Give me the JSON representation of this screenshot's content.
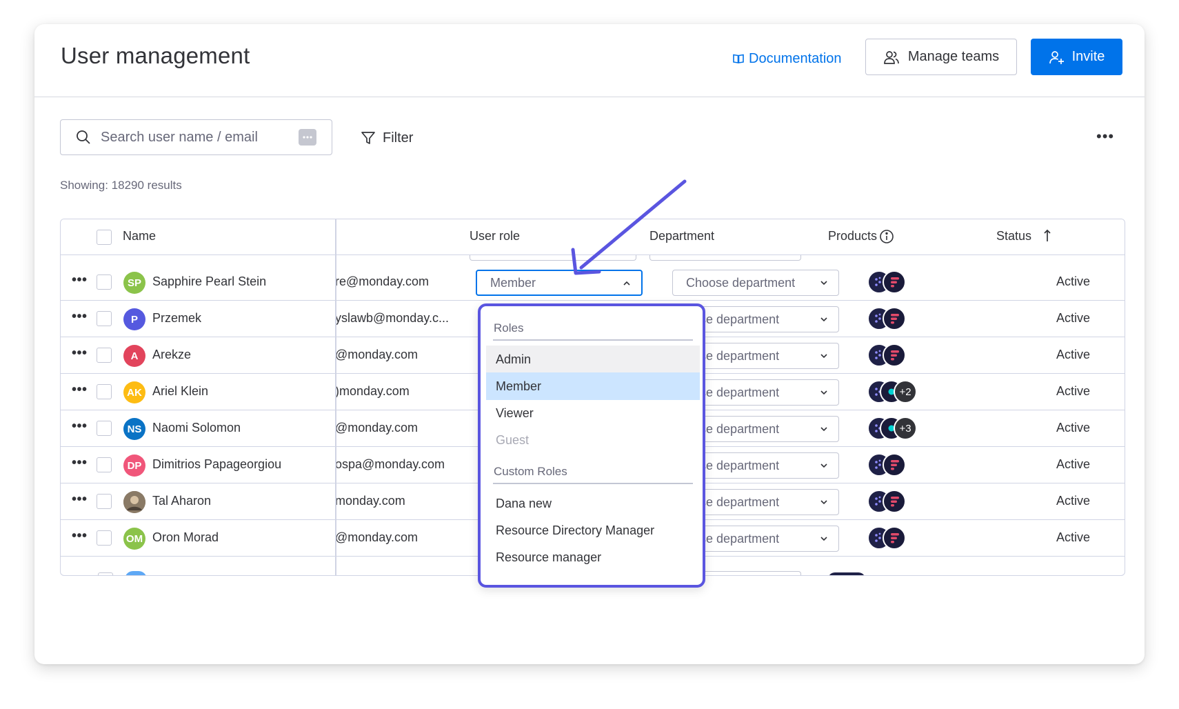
{
  "header": {
    "title": "User management",
    "documentation_label": "Documentation",
    "manage_teams_label": "Manage teams",
    "invite_label": "Invite"
  },
  "toolbar": {
    "search_placeholder": "Search user name / email",
    "filter_label": "Filter",
    "more_label": "•••"
  },
  "showing_text": "Showing: 18290 results",
  "table": {
    "columns": {
      "name": "Name",
      "user_role": "User role",
      "department": "Department",
      "products": "Products",
      "status": "Status"
    },
    "rows": [
      {
        "initials": "SP",
        "avatar_color": "#8bc34a",
        "name": "Sapphire Pearl Stein",
        "email": "re@monday.com",
        "role": "Member",
        "department": "Choose department",
        "products_more": "",
        "status": "Active"
      },
      {
        "initials": "P",
        "avatar_color": "#5559df",
        "name": "Przemek",
        "email": "yslawb@monday.c...",
        "role": "",
        "department": "oose department",
        "products_more": "",
        "status": "Active"
      },
      {
        "initials": "A",
        "avatar_color": "#e2445c",
        "name": "Arekze",
        "email": "@monday.com",
        "role": "",
        "department": "oose department",
        "products_more": "",
        "status": "Active"
      },
      {
        "initials": "AK",
        "avatar_color": "#fdbc13",
        "name": "Ariel Klein",
        "email": ")monday.com",
        "role": "",
        "department": "oose department",
        "products_more": "+2",
        "status": "Active"
      },
      {
        "initials": "NS",
        "avatar_color": "#0a73c5",
        "name": "Naomi Solomon",
        "email": "@monday.com",
        "role": "",
        "department": "oose department",
        "products_more": "+3",
        "status": "Active"
      },
      {
        "initials": "DP",
        "avatar_color": "#f0567a",
        "name": "Dimitrios Papageorgiou",
        "email": "ospa@monday.com",
        "role": "",
        "department": "oose department",
        "products_more": "",
        "status": "Active"
      },
      {
        "initials": "",
        "avatar_color": "#8a7a66",
        "name": "Tal Aharon",
        "email": "monday.com",
        "role": "",
        "department": "oose department",
        "products_more": "",
        "status": "Active"
      },
      {
        "initials": "OM",
        "avatar_color": "#8bc34a",
        "name": "Oron Morad",
        "email": "@monday.com",
        "role": "",
        "department": "oose department",
        "products_more": "",
        "status": "Active"
      }
    ]
  },
  "role_dropdown": {
    "roles_heading": "Roles",
    "roles": [
      "Admin",
      "Member",
      "Viewer",
      "Guest"
    ],
    "selected": "Member",
    "custom_heading": "Custom Roles",
    "custom_roles": [
      "Dana new",
      "Resource Directory Manager",
      "Resource manager"
    ]
  },
  "colors": {
    "accent": "#0073ea",
    "highlight": "#5a55e0",
    "selected_bg": "#cce5ff"
  }
}
